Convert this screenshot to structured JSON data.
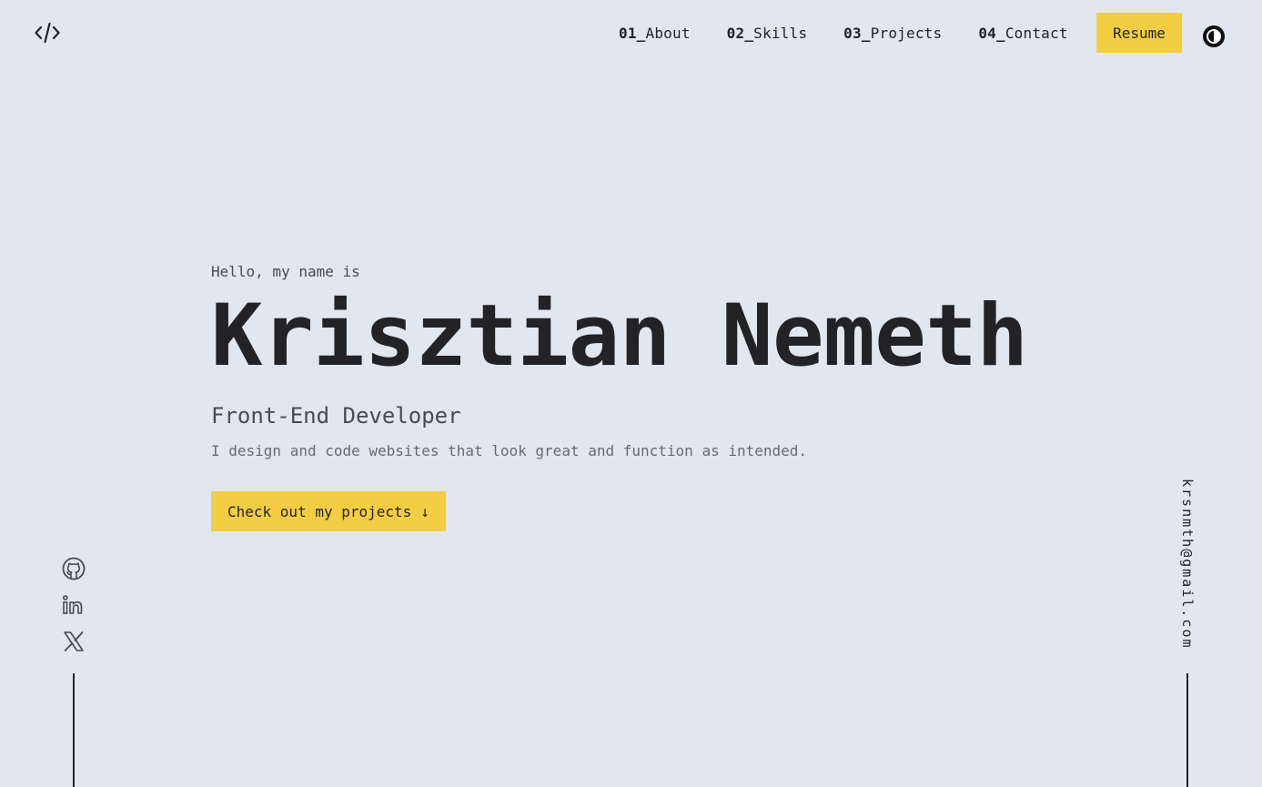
{
  "header": {
    "logo_icon": "code-brackets-icon",
    "nav": [
      {
        "num": "01_",
        "label": "About"
      },
      {
        "num": "02_",
        "label": "Skills"
      },
      {
        "num": "03_",
        "label": "Projects"
      },
      {
        "num": "04_",
        "label": "Contact"
      }
    ],
    "resume_label": "Resume",
    "theme_toggle_icon": "contrast-icon"
  },
  "hero": {
    "greeting": "Hello, my name is",
    "name": "Krisztian Nemeth",
    "role": "Front-End Developer",
    "tagline": "I design and code websites that look great and function as intended.",
    "cta_label": "Check out my projects",
    "cta_arrow": "↓"
  },
  "social": [
    {
      "icon": "github-icon"
    },
    {
      "icon": "linkedin-icon"
    },
    {
      "icon": "x-icon"
    }
  ],
  "email": "krsnmth@gmail.com",
  "colors": {
    "background": "#e2e6ed",
    "accent": "#f3ce43",
    "text": "#232325"
  }
}
